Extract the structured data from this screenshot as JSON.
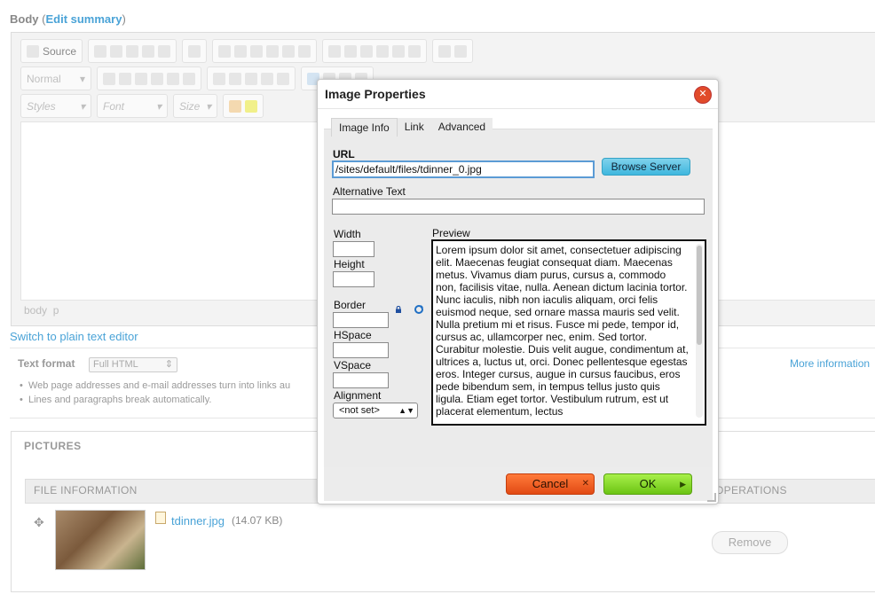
{
  "page": {
    "body_label": "Body",
    "edit_summary_link": "Edit summary",
    "paren_open": "(",
    "paren_close": ")",
    "toolbar": {
      "source_label": "Source",
      "format_combo": "Normal",
      "styles_combo": "Styles",
      "font_combo": "Font",
      "size_combo": "Size"
    },
    "path_bar": [
      "body",
      "p"
    ],
    "switch_link": "Switch to plain text editor",
    "text_format": {
      "label": "Text format",
      "selected": "Full HTML",
      "more_info": "More information",
      "tips": [
        "Web page addresses and e-mail addresses turn into links au",
        "Lines and paragraphs break automatically."
      ]
    },
    "pictures": {
      "title": "PICTURES",
      "columns": {
        "file_info": "FILE INFORMATION",
        "operations": "OPERATIONS"
      },
      "file": {
        "name": "tdinner.jpg",
        "size": "(14.07 KB)"
      },
      "remove_label": "Remove"
    }
  },
  "dialog": {
    "title": "Image Properties",
    "close_glyph": "✕",
    "tabs": [
      "Image Info",
      "Link",
      "Advanced"
    ],
    "url_label": "URL",
    "url_value": "/sites/default/files/tdinner_0.jpg",
    "browse_label": "Browse Server",
    "alt_label": "Alternative Text",
    "alt_value": "",
    "width_label": "Width",
    "height_label": "Height",
    "border_label": "Border",
    "hspace_label": "HSpace",
    "vspace_label": "VSpace",
    "alignment_label": "Alignment",
    "alignment_value": "<not set>",
    "preview_label": "Preview",
    "preview_text": "Lorem ipsum dolor sit amet, consectetuer adipiscing elit. Maecenas feugiat consequat diam. Maecenas metus. Vivamus diam purus, cursus a, commodo non, facilisis vitae, nulla. Aenean dictum lacinia tortor. Nunc iaculis, nibh non iaculis aliquam, orci felis euismod neque, sed ornare massa mauris sed velit. Nulla pretium mi et risus. Fusce mi pede, tempor id, cursus ac, ullamcorper nec, enim. Sed tortor. Curabitur molestie. Duis velit augue, condimentum at, ultrices a, luctus ut, orci. Donec pellentesque egestas eros. Integer cursus, augue in cursus faucibus, eros pede bibendum sem, in tempus tellus justo quis ligula. Etiam eget tortor. Vestibulum rutrum, est ut placerat elementum, lectus",
    "cancel_label": "Cancel",
    "ok_label": "OK"
  },
  "colors": {
    "link": "#4aa3d7",
    "cancel": "#e24a14",
    "ok": "#6cc414",
    "browse": "#3fb7de",
    "close": "#e14b2a"
  }
}
